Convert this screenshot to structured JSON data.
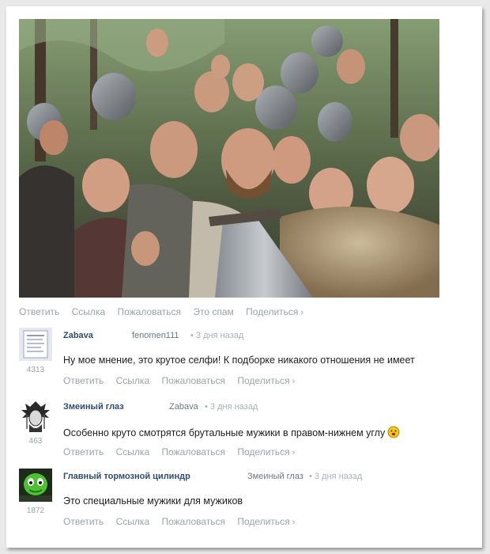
{
  "post_actions": {
    "reply": "Ответить",
    "link": "Ссылка",
    "complain": "Пожаловаться",
    "spam": "Это спам",
    "share": "Поделиться"
  },
  "comments": [
    {
      "author": "Zabava",
      "reply_to": "fenomen111",
      "time": "• 3 дня назад",
      "text": "Ну мое мнение, это крутое селфи! К подборке никакого отношения не имеет",
      "score": "4313",
      "avatar_icon": "note-paper-icon"
    },
    {
      "author": "Змеиный глаз",
      "reply_to": "Zabava",
      "time": "• 3 дня назад",
      "text": "Особенно круто смотрятся брутальные мужики в правом-нижнем углу",
      "score": "463",
      "avatar_icon": "native-chief-icon"
    },
    {
      "author": "Главный тормозной цилиндр",
      "reply_to": "Змеиный глаз",
      "time": "• 3 дня назад",
      "text": "Это специальные мужики для мужиков",
      "score": "1872",
      "avatar_icon": "green-creature-icon"
    }
  ],
  "comment_actions": {
    "reply": "Ответить",
    "link": "Ссылка",
    "complain": "Пожаловаться",
    "share": "Поделиться"
  },
  "colors": {
    "author": "#2e4b70",
    "meta": "#9aa3ad",
    "text": "#222222",
    "background": "#e9e9e9"
  }
}
